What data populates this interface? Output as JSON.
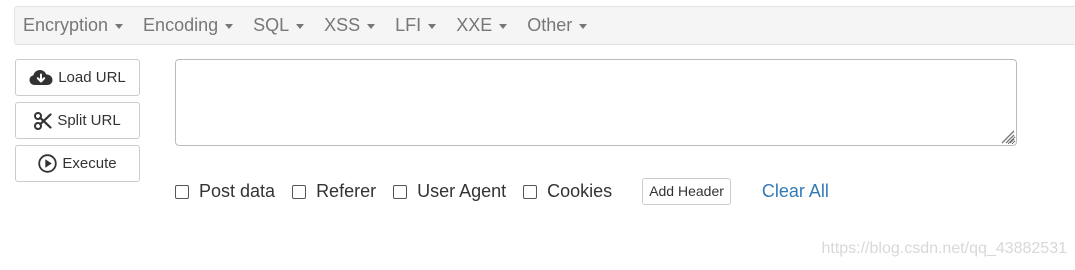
{
  "menu": {
    "items": [
      {
        "label": "Encryption"
      },
      {
        "label": "Encoding"
      },
      {
        "label": "SQL"
      },
      {
        "label": "XSS"
      },
      {
        "label": "LFI"
      },
      {
        "label": "XXE"
      },
      {
        "label": "Other"
      }
    ]
  },
  "actions": {
    "load_url": {
      "label": "Load URL",
      "icon": "cloud-download-icon"
    },
    "split_url": {
      "label": "Split URL",
      "icon": "scissors-icon"
    },
    "execute": {
      "label": "Execute",
      "icon": "play-circle-icon"
    }
  },
  "url_input": {
    "value": "",
    "placeholder": ""
  },
  "options": {
    "post_data": {
      "label": "Post data",
      "checked": false
    },
    "referer": {
      "label": "Referer",
      "checked": false
    },
    "user_agent": {
      "label": "User Agent",
      "checked": false
    },
    "cookies": {
      "label": "Cookies",
      "checked": false
    },
    "add_header_label": "Add Header",
    "clear_all_label": "Clear All"
  },
  "watermark": "https://blog.csdn.net/qq_43882531",
  "colors": {
    "menu_bg": "#f5f5f5",
    "menu_text": "#777777",
    "link": "#337ab7",
    "border": "#cccccc"
  }
}
